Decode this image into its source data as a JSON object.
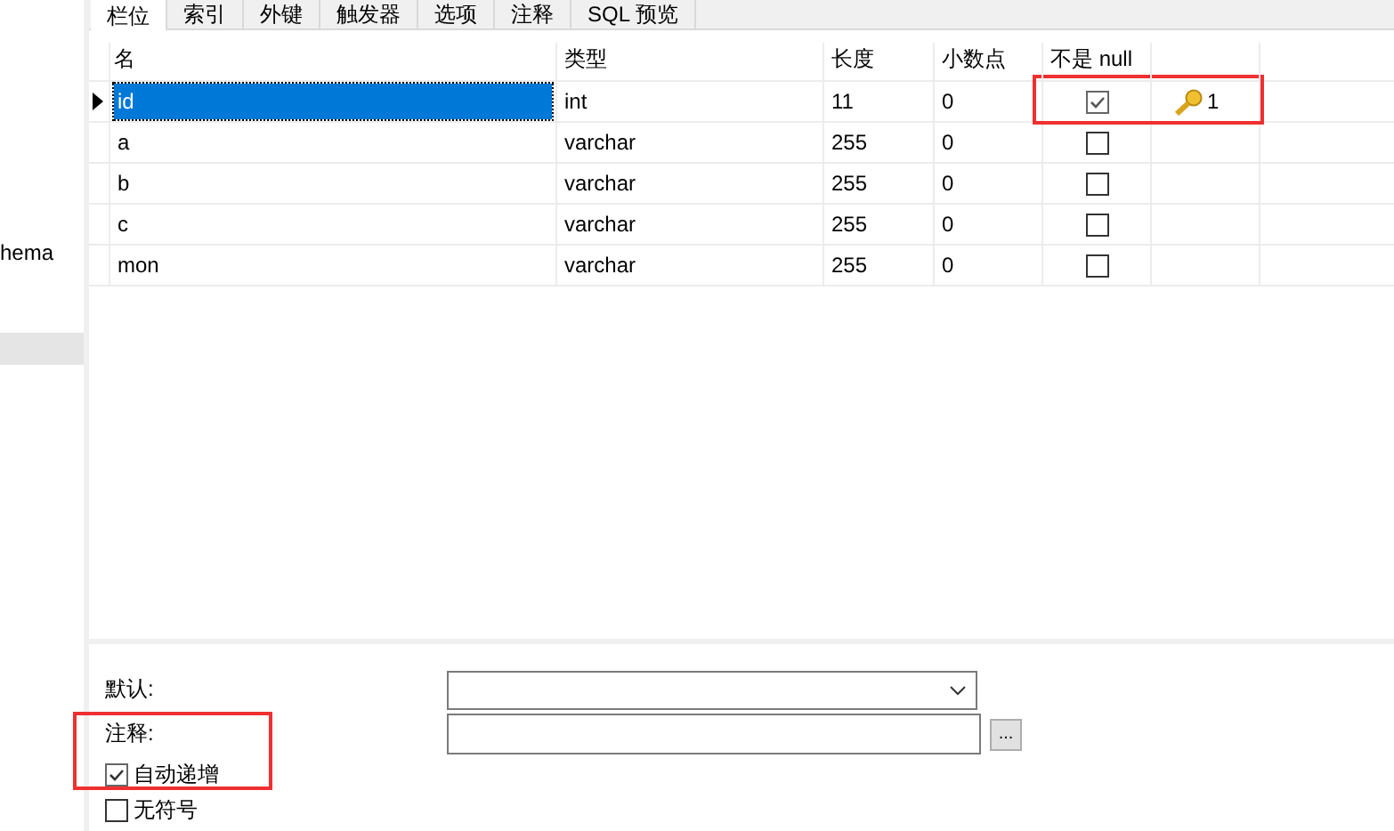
{
  "sidebar": {
    "items": [
      {
        "label": "hema",
        "selected": false
      },
      {
        "selected": true
      }
    ]
  },
  "tabs": [
    {
      "label": "栏位",
      "selected": true
    },
    {
      "label": "索引",
      "selected": false
    },
    {
      "label": "外键",
      "selected": false
    },
    {
      "label": "触发器",
      "selected": false
    },
    {
      "label": "选项",
      "selected": false
    },
    {
      "label": "注释",
      "selected": false
    },
    {
      "label": "SQL 预览",
      "selected": false
    }
  ],
  "table": {
    "columns": [
      "名",
      "类型",
      "长度",
      "小数点",
      "不是 null"
    ],
    "rows": [
      {
        "name": "id",
        "type": "int",
        "length": "11",
        "decimals": "0",
        "not_null": true,
        "key": "1",
        "selected": true
      },
      {
        "name": "a",
        "type": "varchar",
        "length": "255",
        "decimals": "0",
        "not_null": false,
        "selected": false
      },
      {
        "name": "b",
        "type": "varchar",
        "length": "255",
        "decimals": "0",
        "not_null": false,
        "selected": false
      },
      {
        "name": "c",
        "type": "varchar",
        "length": "255",
        "decimals": "0",
        "not_null": false,
        "selected": false
      },
      {
        "name": "mon",
        "type": "varchar",
        "length": "255",
        "decimals": "0",
        "not_null": false,
        "selected": false
      }
    ]
  },
  "properties": {
    "default_label": "默认:",
    "comment_label": "注释:",
    "browse_button": "...",
    "options": [
      {
        "label": "自动递增",
        "checked": true
      },
      {
        "label": "无符号",
        "checked": false
      }
    ]
  }
}
